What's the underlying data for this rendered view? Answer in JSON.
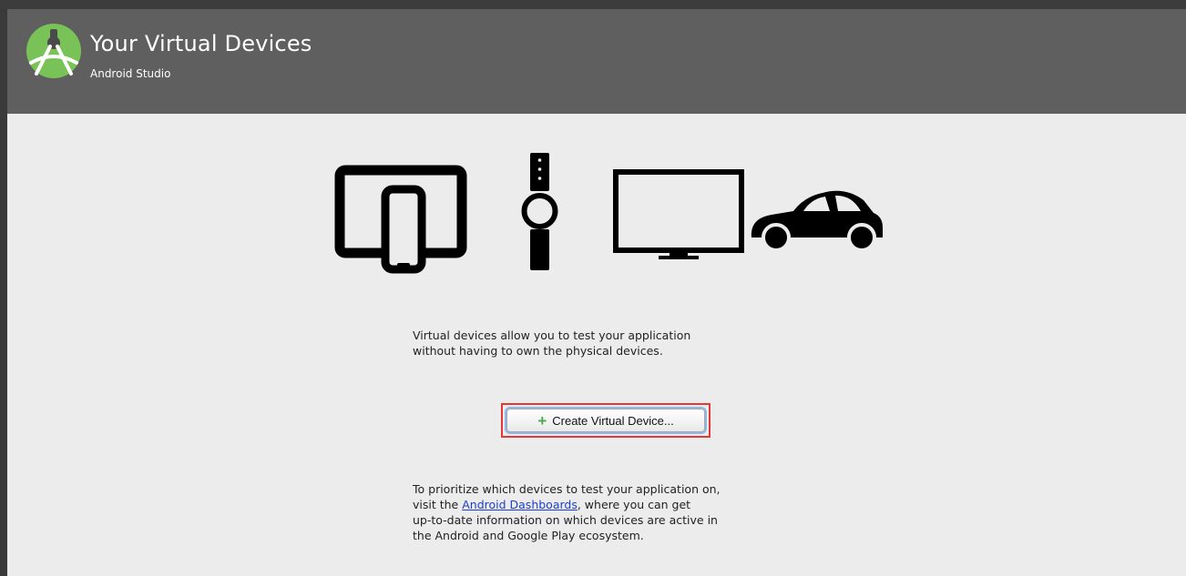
{
  "header": {
    "title": "Your Virtual Devices",
    "subtitle": "Android Studio",
    "logo_icon": "android-studio-logo-icon"
  },
  "device_icons": [
    "tablet-phone-icon",
    "watch-icon",
    "tv-icon",
    "car-icon"
  ],
  "intro_text": {
    "line1": "Virtual devices allow you to test your application",
    "line2": "without having to own the physical devices."
  },
  "create_button": {
    "icon": "+",
    "label": "Create Virtual Device..."
  },
  "dashboard_text": {
    "line1": "To prioritize which devices to test your application on,",
    "line2_before": "visit the ",
    "link": "Android Dashboards",
    "line2_after": ", where you can get",
    "line3": "up-to-date information on which devices are active in",
    "line4": "the Android and Google Play ecosystem."
  },
  "colors": {
    "header_bg": "#5f5f5f",
    "content_bg": "#ececec",
    "highlight": "#e23838",
    "link": "#1a3fd0",
    "logo_green": "#78c257"
  }
}
